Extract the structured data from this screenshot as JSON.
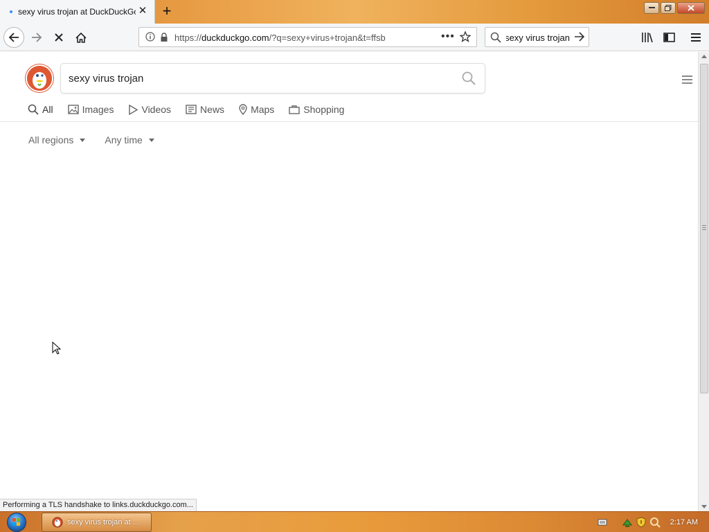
{
  "browser": {
    "tab": {
      "title": "sexy virus trojan at DuckDuckGo"
    },
    "url": {
      "prefix": "https://",
      "domain": "duckduckgo.com",
      "path": "/?q=sexy+virus+trojan&t=ffsb"
    },
    "searchbox": {
      "value": "sexy virus trojan"
    },
    "status_text": "Performing a TLS handshake to links.duckduckgo.com..."
  },
  "ddg": {
    "query": "sexy virus trojan",
    "tabs": [
      {
        "label": "All",
        "icon": "search-icon"
      },
      {
        "label": "Images",
        "icon": "image-icon"
      },
      {
        "label": "Videos",
        "icon": "play-icon"
      },
      {
        "label": "News",
        "icon": "newspaper-icon"
      },
      {
        "label": "Maps",
        "icon": "map-pin-icon"
      },
      {
        "label": "Shopping",
        "icon": "shopping-bag-icon"
      }
    ],
    "filters": {
      "region": "All regions",
      "time": "Any time"
    }
  },
  "taskbar": {
    "task_label": "sexy virus trojan at ...",
    "clock": "2:17 AM"
  },
  "colors": {
    "ddg_orange": "#de5833",
    "link_blue": "#3c8ef0",
    "taskbar": "#e5a04a"
  }
}
